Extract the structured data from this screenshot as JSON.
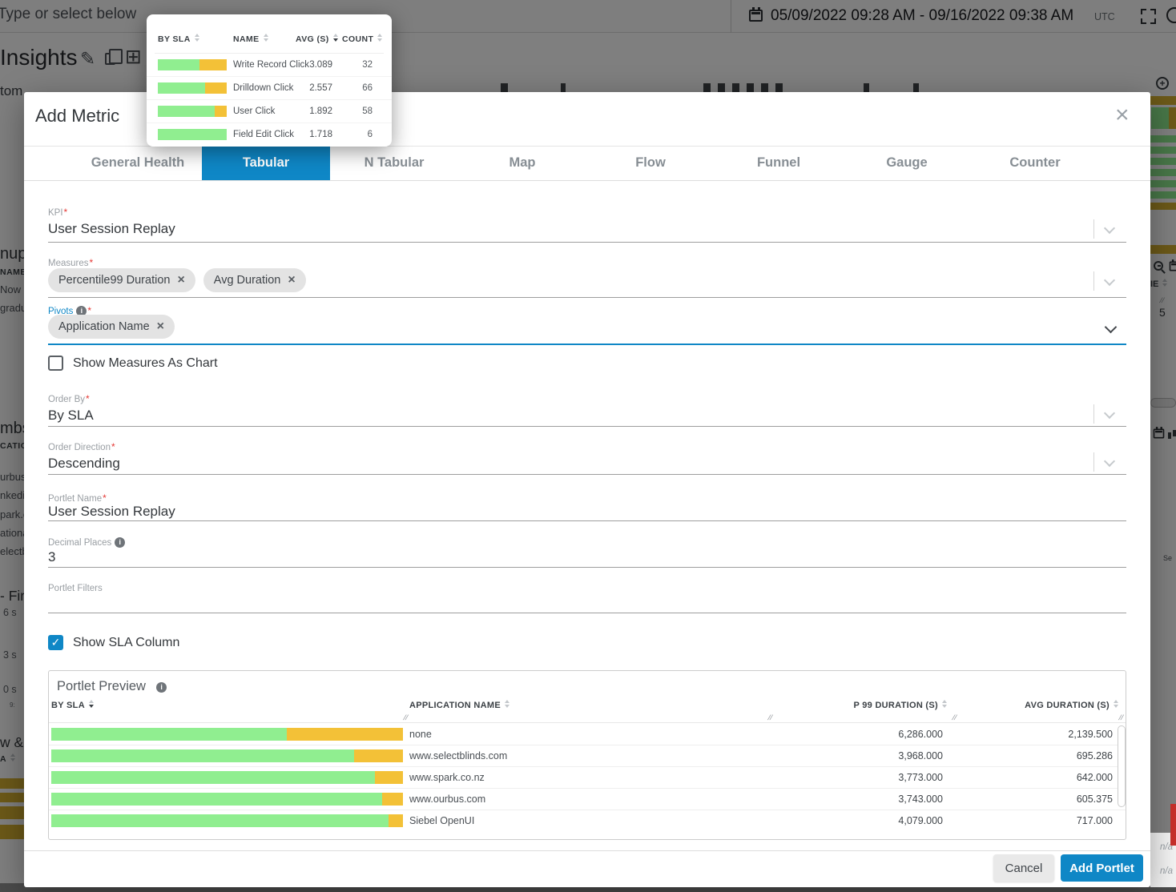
{
  "colors": {
    "accent_blue": "#0f87c6",
    "bar_green": "#90ee90",
    "bar_yellow": "#f3c137",
    "required_red": "#e53935"
  },
  "background": {
    "search_placeholder": "Type or select below",
    "page_title": "Insights",
    "partial_text": "tom",
    "date_range": "05/09/2022 09:28 AM - 09/16/2022 09:38 AM",
    "timezone": "UTC",
    "left_fragments": [
      "nup",
      "NAME",
      "Now",
      "gradu",
      "mbs",
      "CATIO",
      "urbus",
      "nkedi",
      "park.c",
      "ationa",
      "electb",
      "- Fir",
      "6 s",
      "3 s",
      "0 s",
      "9:",
      "w &",
      "A"
    ],
    "right_fragments": {
      "column_header": "IE",
      "row_value": "5",
      "note_1": "n/a",
      "note_2": "n/a",
      "label": "Se"
    }
  },
  "popup": {
    "columns": [
      "BY SLA",
      "NAME",
      "AVG (S)",
      "COUNT"
    ],
    "sorted_by": "AVG (S)",
    "sort_direction": "descending",
    "rows": [
      {
        "name": "Write Record Click",
        "avg": "3.089",
        "count": "32",
        "green_pct": 60
      },
      {
        "name": "Drilldown Click",
        "avg": "2.557",
        "count": "66",
        "green_pct": 69
      },
      {
        "name": "User Click",
        "avg": "1.892",
        "count": "58",
        "green_pct": 83
      },
      {
        "name": "Field Edit Click",
        "avg": "1.718",
        "count": "6",
        "green_pct": 100
      }
    ]
  },
  "modal": {
    "title": "Add Metric",
    "tabs": [
      {
        "label": "General Health",
        "active": false
      },
      {
        "label": "Tabular",
        "active": true
      },
      {
        "label": "N Tabular",
        "active": false
      },
      {
        "label": "Map",
        "active": false
      },
      {
        "label": "Flow",
        "active": false
      },
      {
        "label": "Funnel",
        "active": false
      },
      {
        "label": "Gauge",
        "active": false
      },
      {
        "label": "Counter",
        "active": false
      }
    ],
    "fields": {
      "kpi": {
        "label": "KPI",
        "value": "User Session Replay"
      },
      "measures": {
        "label": "Measures",
        "chips": [
          "Percentile99 Duration",
          "Avg Duration"
        ]
      },
      "pivots": {
        "label": "Pivots",
        "chips": [
          "Application Name"
        ]
      },
      "show_measures_as_chart": {
        "label": "Show Measures As Chart",
        "checked": false
      },
      "order_by": {
        "label": "Order By",
        "value": "By SLA"
      },
      "order_direction": {
        "label": "Order Direction",
        "value": "Descending"
      },
      "portlet_name": {
        "label": "Portlet Name",
        "value": "User Session Replay"
      },
      "decimal_places": {
        "label": "Decimal Places",
        "value": "3"
      },
      "portlet_filters": {
        "label": "Portlet Filters",
        "value": ""
      },
      "show_sla_column": {
        "label": "Show SLA Column",
        "checked": true
      }
    },
    "preview": {
      "title": "Portlet Preview",
      "columns": [
        "BY SLA",
        "APPLICATION NAME",
        "P 99 DURATION (S)",
        "AVG DURATION (S)"
      ],
      "sorted_by": "BY SLA",
      "sort_direction": "descending",
      "rows": [
        {
          "application": "none",
          "p99": "6,286.000",
          "avg": "2,139.500",
          "green_pct": 67
        },
        {
          "application": "www.selectblinds.com",
          "p99": "3,968.000",
          "avg": "695.286",
          "green_pct": 86
        },
        {
          "application": "www.spark.co.nz",
          "p99": "3,773.000",
          "avg": "642.000",
          "green_pct": 92
        },
        {
          "application": "www.ourbus.com",
          "p99": "3,743.000",
          "avg": "605.375",
          "green_pct": 94
        },
        {
          "application": "Siebel OpenUI",
          "p99": "4,079.000",
          "avg": "717.000",
          "green_pct": 96
        }
      ]
    },
    "footer": {
      "cancel_label": "Cancel",
      "submit_label": "Add Portlet"
    }
  }
}
